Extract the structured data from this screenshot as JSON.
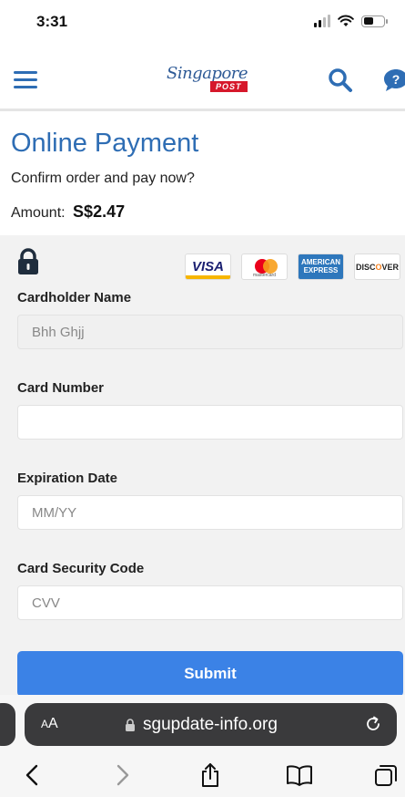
{
  "status_bar": {
    "time": "3:31"
  },
  "header": {
    "logo_script": "Singapore",
    "logo_post": "POST"
  },
  "main": {
    "title": "Online Payment",
    "confirm_text": "Confirm order and pay now?",
    "amount_label": "Amount:",
    "amount_value": "S$2.47"
  },
  "payment": {
    "card_logos": {
      "visa": "VISA",
      "mastercard": "mastercard",
      "amex_line1": "AMERICAN",
      "amex_line2": "EXPRESS",
      "discover_a": "DISC",
      "discover_o": "O",
      "discover_b": "VER"
    },
    "cardholder": {
      "label": "Cardholder Name",
      "value": "Bhh Ghjj"
    },
    "card_number": {
      "label": "Card Number",
      "value": "",
      "placeholder": ""
    },
    "expiration": {
      "label": "Expiration Date",
      "placeholder": "MM/YY"
    },
    "security_code": {
      "label": "Card Security Code",
      "placeholder": "CVV"
    },
    "submit_label": "Submit"
  },
  "browser": {
    "aa_small": "A",
    "aa_large": "A",
    "url": "sgupdate-info.org"
  },
  "colors": {
    "accent_blue": "#2e6db4",
    "submit_blue": "#3b82e6",
    "brand_red": "#d6182b"
  }
}
